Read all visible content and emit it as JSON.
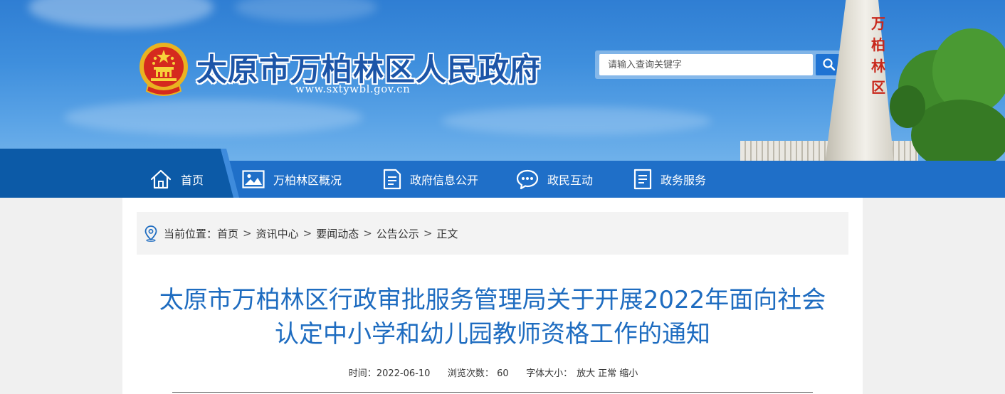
{
  "header": {
    "site_title": "太原市万柏林区人民政府",
    "site_url": "www.sxtywbl.gov.cn",
    "monument_text": [
      "万",
      "柏",
      "林",
      "区"
    ]
  },
  "search": {
    "placeholder": "请输入查询关键字",
    "value": ""
  },
  "nav": {
    "items": [
      {
        "label": "首页",
        "icon": "home-icon"
      },
      {
        "label": "万柏林区概况",
        "icon": "image-icon"
      },
      {
        "label": "政府信息公开",
        "icon": "document-icon"
      },
      {
        "label": "政民互动",
        "icon": "chat-icon"
      },
      {
        "label": "政务服务",
        "icon": "document-icon"
      }
    ]
  },
  "breadcrumb": {
    "prefix": "当前位置：",
    "items": [
      "首页",
      "资讯中心",
      "要闻动态",
      "公告公示",
      "正文"
    ],
    "separator": ">"
  },
  "article": {
    "title_line1": "太原市万柏林区行政审批服务管理局关于开展2022年面向社会",
    "title_line2": "认定中小学和幼儿园教师资格工作的通知",
    "time_label": "时间：",
    "time_value": "2022-06-10",
    "views_label": "浏览次数：",
    "views_value": "60",
    "font_label": "字体大小：",
    "font_large": "放大",
    "font_normal": "正常",
    "font_small": "缩小"
  },
  "colors": {
    "nav_bg": "#1f6fc8",
    "nav_home_bg": "#0c5aa7",
    "title_blue": "#1e6cc0",
    "search_button": "#1f73d3"
  }
}
